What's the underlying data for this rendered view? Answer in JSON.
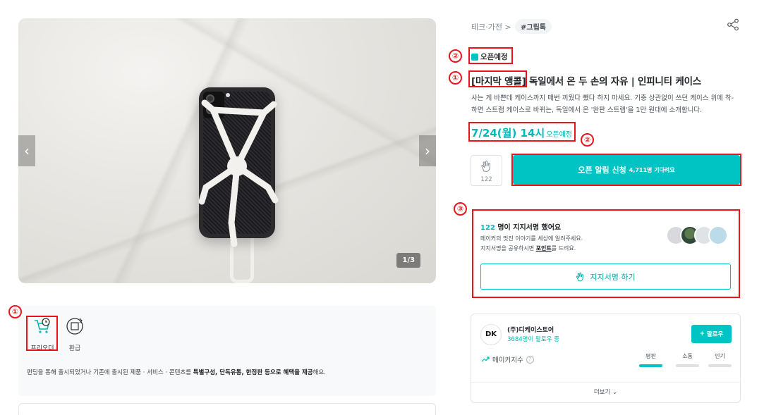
{
  "gallery": {
    "counter": "1/3",
    "prev_icon": "chevron-left-icon",
    "next_icon": "chevron-right-icon"
  },
  "benefits": {
    "items": [
      {
        "label": "프리오더",
        "icon": "cart-clock-icon"
      },
      {
        "label": "환급",
        "icon": "refund-icon"
      }
    ],
    "desc_prefix": "펀딩을 통해 출시되었거나 기존에 출시된 제품 · 서비스 · 콘텐츠를 ",
    "desc_bold1": "특별구성, 단독유통, 한정판 등으로 혜택을 제공",
    "desc_suffix": "해요."
  },
  "header": {
    "breadcrumb": "테크·가전",
    "breadcrumb_sep": ">",
    "tag": "#그립톡"
  },
  "product": {
    "status": "오픈예정",
    "title_bracket": "[마지막 앵콜]",
    "title_rest": " 독일에서 온 두 손의 자유 | 인피니티 케이스",
    "desc": "사는 게 바쁜데 케이스까지 매번 끼웠다 뺐다 하지 마세요. 기충 상관없이 쓰던 케이스 위에 착-하면 스트랩 케이스로 바뀌는, 독일에서 온 '완판 스트랩'을 1만 원대에 소개합니다.",
    "open_date": "7/24(월) 14시",
    "open_label": "오픈예정"
  },
  "actions": {
    "like_count": "122",
    "notify_label": "오픈 알림 신청",
    "notify_sub": "4,711명 기다려요"
  },
  "support": {
    "count": "122",
    "title_suffix": " 명이 지지서명 했어요",
    "line1": "메이커의 멋진 이야기를 세상에 알려주세요.",
    "line2_prefix": "지지서명을 공유하시면 ",
    "line2_link": "포인트",
    "line2_suffix": "를 드려요.",
    "button_label": "지지서명 하기"
  },
  "maker": {
    "logo_text": "DK",
    "name": "(주)디케이스토어",
    "followers": "3684명이 팔로우 중",
    "follow_label": "팔로우",
    "index_label": "메이커지수",
    "metrics": [
      {
        "label": "평판",
        "active": true
      },
      {
        "label": "소통",
        "active": false
      },
      {
        "label": "인기",
        "active": false
      }
    ],
    "more_label": "더보기"
  },
  "annotations": [
    "①",
    "②",
    "②",
    "①",
    "③"
  ],
  "colors": {
    "accent": "#00c4c4",
    "annotation": "#e8151c"
  }
}
